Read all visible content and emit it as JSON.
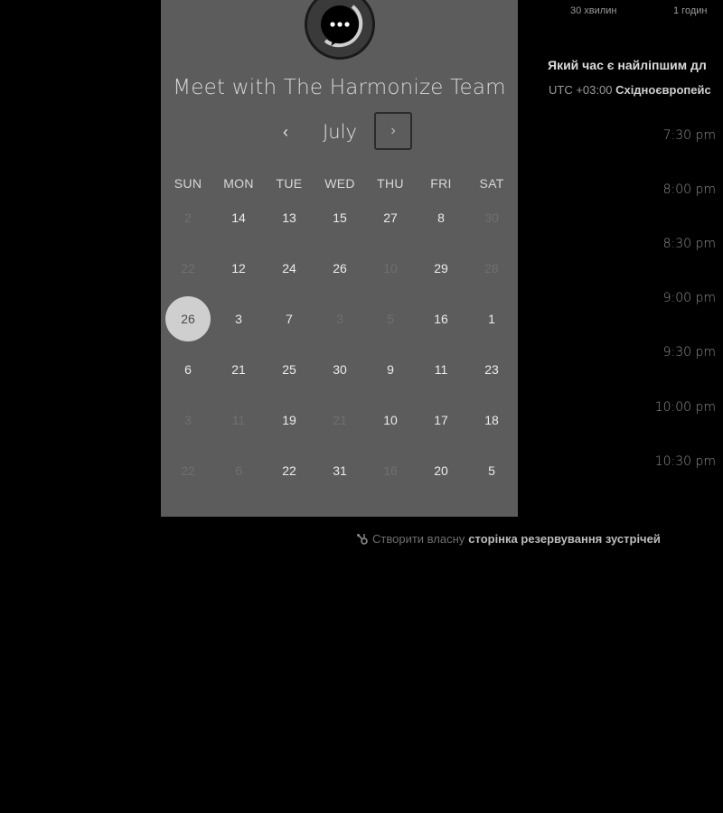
{
  "header": {
    "title": "Meet with The Harmonize Team",
    "month": "July",
    "prev_symbol": "‹",
    "next_symbol": "›"
  },
  "calendar": {
    "weekdays": [
      "SUN",
      "MON",
      "TUE",
      "WED",
      "THU",
      "FRI",
      "SAT"
    ],
    "weeks": [
      [
        {
          "d": "2",
          "m": true
        },
        {
          "d": "14"
        },
        {
          "d": "13"
        },
        {
          "d": "15"
        },
        {
          "d": "27"
        },
        {
          "d": "8"
        },
        {
          "d": "30",
          "m": true
        }
      ],
      [
        {
          "d": "22",
          "m": true
        },
        {
          "d": "12"
        },
        {
          "d": "24"
        },
        {
          "d": "26"
        },
        {
          "d": "10",
          "m": true
        },
        {
          "d": "29"
        },
        {
          "d": "28",
          "m": true
        }
      ],
      [
        {
          "d": "26",
          "s": true
        },
        {
          "d": "3"
        },
        {
          "d": "7"
        },
        {
          "d": "3",
          "m": true
        },
        {
          "d": "5",
          "m": true
        },
        {
          "d": "16"
        },
        {
          "d": "1"
        }
      ],
      [
        {
          "d": "6"
        },
        {
          "d": "21"
        },
        {
          "d": "25"
        },
        {
          "d": "30"
        },
        {
          "d": "9"
        },
        {
          "d": "11"
        },
        {
          "d": "23"
        }
      ],
      [
        {
          "d": "3",
          "m": true
        },
        {
          "d": "11",
          "m": true
        },
        {
          "d": "19"
        },
        {
          "d": "21",
          "m": true
        },
        {
          "d": "10"
        },
        {
          "d": "17"
        },
        {
          "d": "18"
        }
      ],
      [
        {
          "d": "22",
          "m": true
        },
        {
          "d": "6",
          "m": true
        },
        {
          "d": "22"
        },
        {
          "d": "31"
        },
        {
          "d": "16",
          "m": true
        },
        {
          "d": "20"
        },
        {
          "d": "5"
        }
      ]
    ]
  },
  "durations": [
    "30 хвилин",
    "1 годин"
  ],
  "right": {
    "question": "Який час є найліпшим дл",
    "timezone_prefix": "UTC +03:00",
    "timezone_name": "Східноєвропейс"
  },
  "time_slots": [
    "7:30 pm",
    "8:00 pm",
    "8:30 pm",
    "9:00 pm",
    "9:30 pm",
    "10:00 pm",
    "10:30 pm"
  ],
  "footer": {
    "text": "Створити власну",
    "link": "сторінка резервування зустрічей"
  },
  "colors": {
    "panel": "#5c5c5c",
    "background": "#000000",
    "selected_day": "#cfcfcf"
  },
  "icons": {
    "avatar": "chat-bubble-icon",
    "footer": "sprocket-icon"
  }
}
